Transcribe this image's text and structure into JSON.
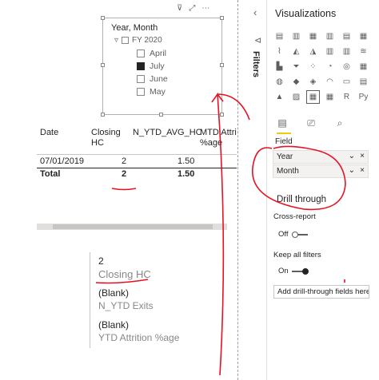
{
  "slicer": {
    "title": "Year, Month",
    "group": "FY 2020",
    "items": [
      {
        "label": "April",
        "checked": false
      },
      {
        "label": "July",
        "checked": true
      },
      {
        "label": "June",
        "checked": false
      },
      {
        "label": "May",
        "checked": false
      }
    ]
  },
  "table": {
    "headers": [
      "Date",
      "Closing HC",
      "N_YTD_AVG_HC",
      "MTD Attri %age"
    ],
    "rows": [
      {
        "date": "07/01/2019",
        "closing_hc": "2",
        "ytd_avg": "1.50"
      }
    ],
    "total": {
      "label": "Total",
      "closing_hc": "2",
      "ytd_avg": "1.50"
    }
  },
  "card": [
    {
      "value": "2",
      "label": "Closing HC"
    },
    {
      "value": "(Blank)",
      "label": "N_YTD Exits"
    },
    {
      "value": "(Blank)",
      "label": "YTD Attrition %age"
    }
  ],
  "filters_label": "Filters",
  "viz": {
    "title": "Visualizations",
    "field_label": "Field",
    "wells": [
      "Year",
      "Month"
    ],
    "drill_title": "Drill through",
    "cross_report": {
      "label": "Cross-report",
      "state": "Off"
    },
    "keep_filters": {
      "label": "Keep all filters",
      "state": "On"
    },
    "add_drill": "Add drill-through fields here",
    "icons": [
      "stacked-bar",
      "stacked-column",
      "clustered-bar",
      "clustered-column",
      "100-bar",
      "100-column",
      "line",
      "area",
      "stacked-area",
      "line-column",
      "line-clustered",
      "ribbon",
      "waterfall",
      "funnel",
      "scatter",
      "pie",
      "donut",
      "treemap",
      "map",
      "filled-map",
      "shape-map",
      "gauge",
      "card",
      "multi-row-card",
      "kpi",
      "slicer",
      "table",
      "matrix",
      "r-visual",
      "python-visual"
    ],
    "icon_glyphs": [
      "▤",
      "▥",
      "▦",
      "▥",
      "▤",
      "▦",
      "⌇",
      "◭",
      "◮",
      "▥",
      "▥",
      "≋",
      "▙",
      "⏷",
      "⁘",
      "◔",
      "◎",
      "▦",
      "◍",
      "◆",
      "◈",
      "◠",
      "▭",
      "▤",
      "▲",
      "▨",
      "▦",
      "▦",
      "R",
      "Py"
    ]
  }
}
